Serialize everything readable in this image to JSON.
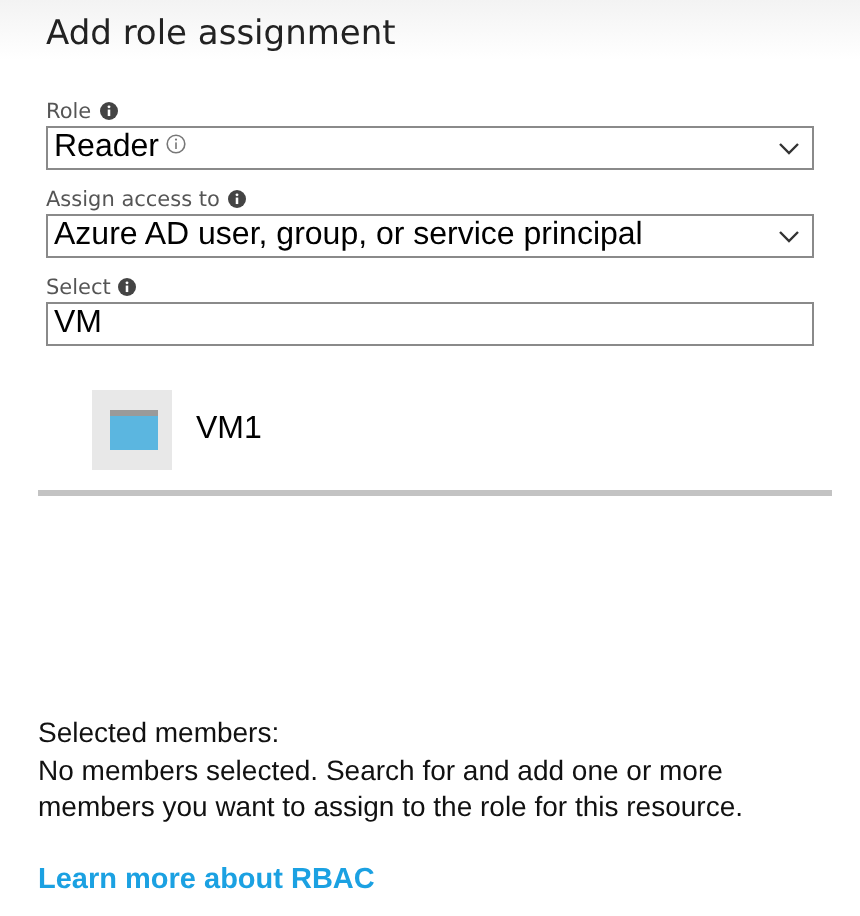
{
  "title": "Add role assignment",
  "fields": [
    {
      "kind": "dropdown",
      "label": "Role",
      "value": "Reader",
      "value_info": true
    },
    {
      "kind": "dropdown",
      "label": "Assign access to",
      "value": "Azure AD user, group, or service principal",
      "value_info": false
    },
    {
      "kind": "text",
      "label": "Select",
      "value": "VM",
      "value_info": false
    }
  ],
  "results": [
    {
      "name": "VM1"
    }
  ],
  "selected_members": {
    "heading": "Selected members:",
    "message": "No members selected. Search for and add one or more members you want to assign to the role for this resource."
  },
  "link": "Learn more about RBAC"
}
